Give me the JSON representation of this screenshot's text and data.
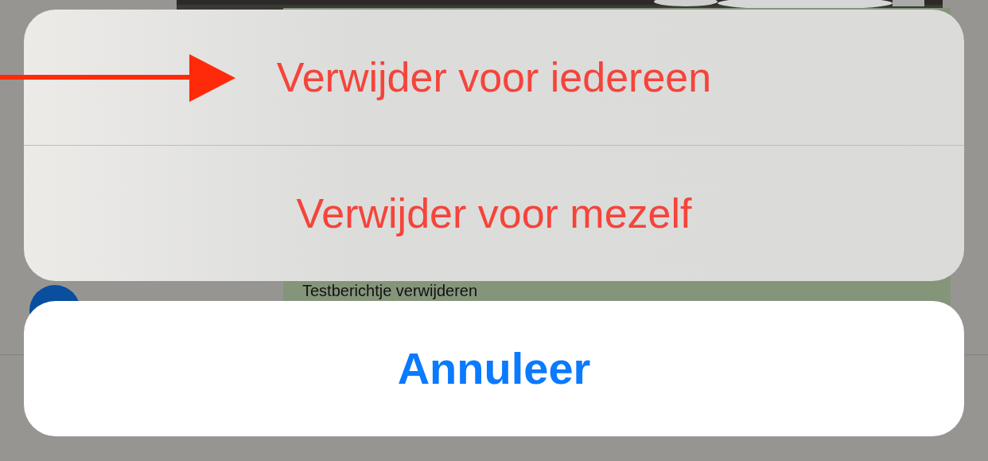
{
  "background": {
    "message": {
      "text": "Testberichtje verwijderen"
    }
  },
  "action_sheet": {
    "actions": [
      {
        "label": "Verwijder voor iedereen",
        "kind": "destructive"
      },
      {
        "label": "Verwijder voor mezelf",
        "kind": "destructive"
      }
    ],
    "cancel": {
      "label": "Annuleer"
    }
  }
}
